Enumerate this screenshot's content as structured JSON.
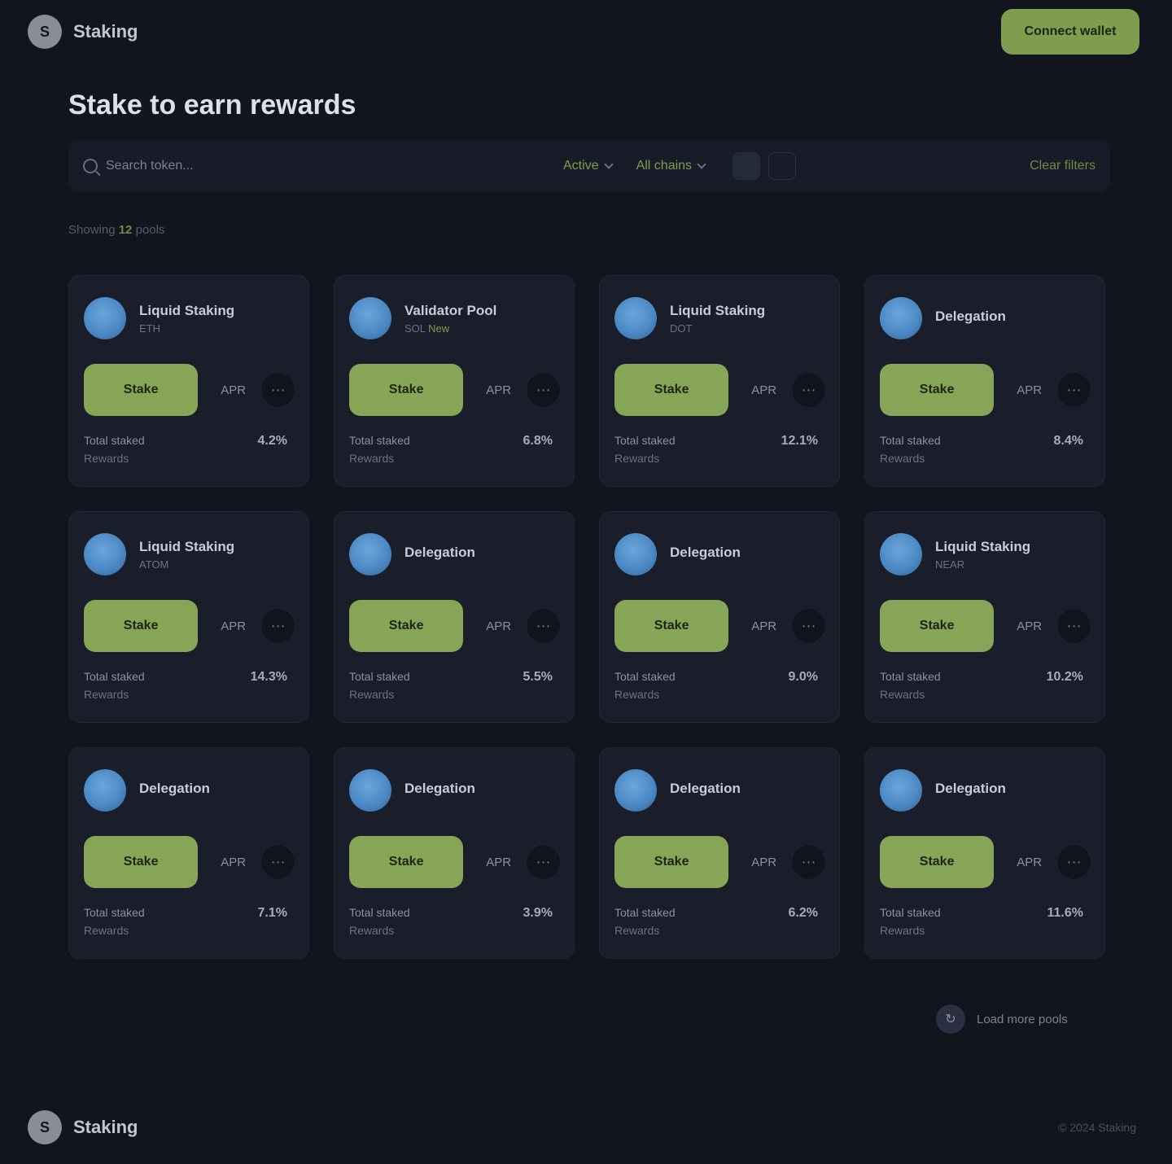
{
  "header": {
    "brand": "Staking",
    "logo_glyph": "S",
    "cta": "Connect wallet"
  },
  "main": {
    "title": "Stake to earn rewards",
    "search_placeholder": "Search token...",
    "filter_status": "Active",
    "filter_chain": "All chains",
    "reset": "Clear filters",
    "count_prefix": "Showing ",
    "count_value": "12",
    "count_suffix": " pools"
  },
  "cards": [
    {
      "name": "Liquid Staking",
      "sub": "ETH",
      "tag": "",
      "action": "Stake",
      "qty": "APR",
      "foot1": "Total staked",
      "foot2": "Rewards",
      "value": "4.2%"
    },
    {
      "name": "Validator Pool",
      "sub": "SOL",
      "tag": "New",
      "action": "Stake",
      "qty": "APR",
      "foot1": "Total staked",
      "foot2": "Rewards",
      "value": "6.8%"
    },
    {
      "name": "Liquid Staking",
      "sub": "DOT",
      "tag": "",
      "action": "Stake",
      "qty": "APR",
      "foot1": "Total staked",
      "foot2": "Rewards",
      "value": "12.1%"
    },
    {
      "name": "Delegation",
      "sub": "",
      "tag": "",
      "action": "Stake",
      "qty": "APR",
      "foot1": "Total staked",
      "foot2": "Rewards",
      "value": "8.4%"
    },
    {
      "name": "Liquid Staking",
      "sub": "ATOM",
      "tag": "",
      "action": "Stake",
      "qty": "APR",
      "foot1": "Total staked",
      "foot2": "Rewards",
      "value": "14.3%"
    },
    {
      "name": "Delegation",
      "sub": "",
      "tag": "",
      "action": "Stake",
      "qty": "APR",
      "foot1": "Total staked",
      "foot2": "Rewards",
      "value": "5.5%"
    },
    {
      "name": "Delegation",
      "sub": "",
      "tag": "",
      "action": "Stake",
      "qty": "APR",
      "foot1": "Total staked",
      "foot2": "Rewards",
      "value": "9.0%"
    },
    {
      "name": "Liquid Staking",
      "sub": "NEAR",
      "tag": "",
      "action": "Stake",
      "qty": "APR",
      "foot1": "Total staked",
      "foot2": "Rewards",
      "value": "10.2%"
    },
    {
      "name": "Delegation",
      "sub": "",
      "tag": "",
      "action": "Stake",
      "qty": "APR",
      "foot1": "Total staked",
      "foot2": "Rewards",
      "value": "7.1%"
    },
    {
      "name": "Delegation",
      "sub": "",
      "tag": "",
      "action": "Stake",
      "qty": "APR",
      "foot1": "Total staked",
      "foot2": "Rewards",
      "value": "3.9%"
    },
    {
      "name": "Delegation",
      "sub": "",
      "tag": "",
      "action": "Stake",
      "qty": "APR",
      "foot1": "Total staked",
      "foot2": "Rewards",
      "value": "6.2%"
    },
    {
      "name": "Delegation",
      "sub": "",
      "tag": "",
      "action": "Stake",
      "qty": "APR",
      "foot1": "Total staked",
      "foot2": "Rewards",
      "value": "11.6%"
    }
  ],
  "pager": {
    "label": "Load more pools"
  },
  "footer": {
    "brand": "Staking",
    "logo_glyph": "S",
    "right": "© 2024 Staking"
  },
  "colors": {
    "accent": "#87a556",
    "background": "#12151e",
    "card": "#1a1e2b"
  },
  "icons": {
    "search": "search-icon",
    "chevron": "chevron-down-icon",
    "more": "more-icon"
  }
}
